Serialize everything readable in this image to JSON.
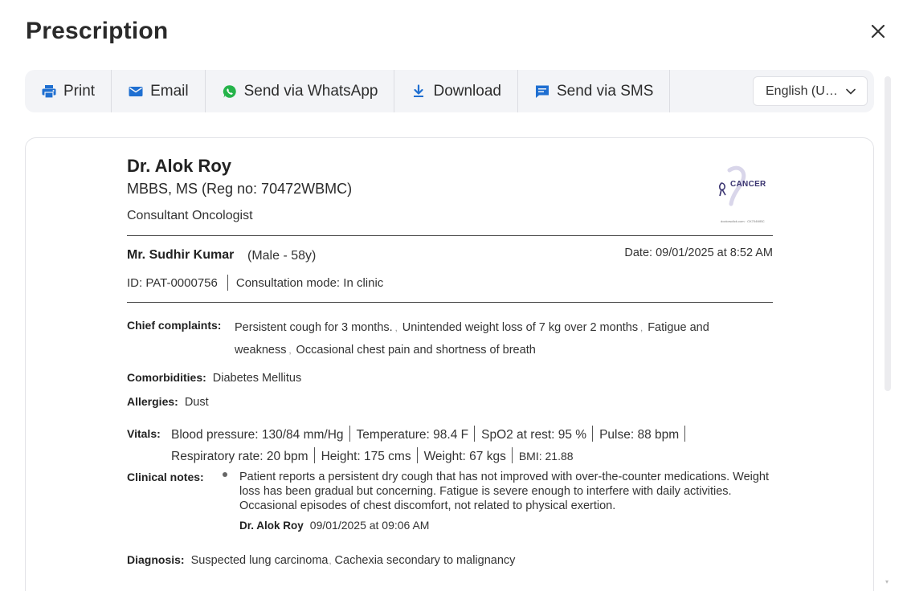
{
  "header": {
    "title": "Prescription"
  },
  "toolbar": {
    "print_label": "Print",
    "email_label": "Email",
    "whatsapp_label": "Send via WhatsApp",
    "download_label": "Download",
    "sms_label": "Send via SMS",
    "language_selected": "English (United States)",
    "accent_color": "#1f6fd1",
    "whatsapp_color": "#25b34a"
  },
  "doctor": {
    "name": "Dr. Alok Roy",
    "qualification": "MBBS, MS (Reg no: 70472WBMC)",
    "role": "Consultant Oncologist",
    "logo_text": "CANCER",
    "logo_subtext": "doctorsclick.com · CK704WBC"
  },
  "patient": {
    "name": "Mr. Sudhir Kumar",
    "meta": "(Male - 58y)",
    "date": "Date: 09/01/2025 at 8:52 AM",
    "id": "ID: PAT-0000756",
    "mode": "Consultation mode: In clinic"
  },
  "chief_complaints": {
    "label": "Chief complaints:",
    "items": [
      "Persistent cough for 3 months.",
      "Unintended weight loss of 7 kg over 2 months",
      "Fatigue and weakness",
      "Occasional chest pain and shortness of breath"
    ]
  },
  "comorbidities": {
    "label": "Comorbidities:",
    "value": "Diabetes Mellitus"
  },
  "allergies": {
    "label": "Allergies:",
    "value": "Dust"
  },
  "vitals": {
    "label": "Vitals:",
    "items": [
      "Blood pressure: 130/84 mm/Hg",
      "Temperature: 98.4 F",
      "SpO2 at rest: 95 %",
      "Pulse: 88 bpm",
      "Respiratory rate: 20 bpm",
      "Height: 175 cms",
      "Weight: 67 kgs",
      "BMI: 21.88"
    ]
  },
  "clinical_notes": {
    "label": "Clinical notes:",
    "text": "Patient reports a persistent dry cough that has not improved with over-the-counter medications. Weight loss has been gradual but concerning. Fatigue is severe enough to interfere with daily activities. Occasional episodes of chest discomfort, not related to physical exertion.",
    "author": "Dr. Alok Roy",
    "timestamp": "09/01/2025 at 09:06 AM"
  },
  "diagnosis": {
    "label": "Diagnosis:",
    "items": [
      "Suspected lung carcinoma",
      "Cachexia secondary to malignancy"
    ]
  }
}
